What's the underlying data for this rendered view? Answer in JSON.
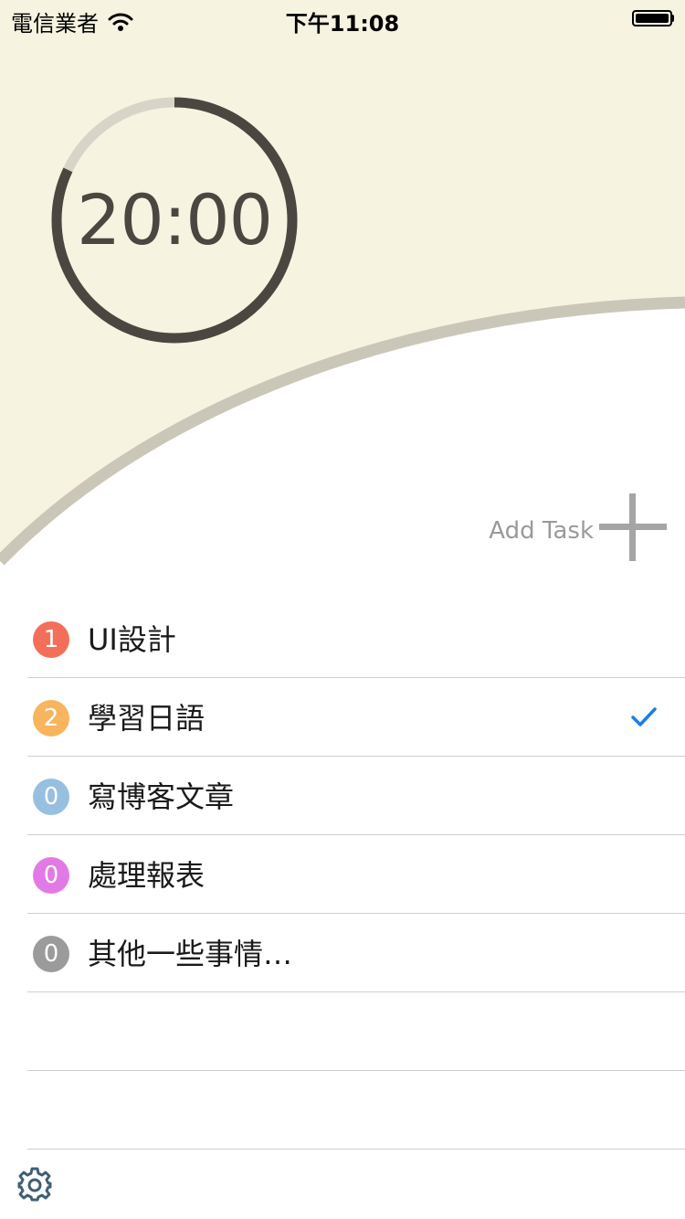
{
  "status_bar": {
    "carrier": "電信業者",
    "time": "下午11:08",
    "battery_level": 1.0
  },
  "timer": {
    "display": "20:00",
    "progress": 0.82,
    "ring_color": "#4b4740",
    "track_color": "#d8d5c8"
  },
  "colors": {
    "top_background": "#f6f3e1",
    "wave_stroke": "#cbc7b8",
    "accent_check": "#1a7ee8"
  },
  "add_task": {
    "label": "Add Task",
    "icon": "plus-icon"
  },
  "tasks": [
    {
      "count": "1",
      "name": "UI設計",
      "color": "#f46f5a",
      "checked": false
    },
    {
      "count": "2",
      "name": "學習日語",
      "color": "#f8b55d",
      "checked": true
    },
    {
      "count": "0",
      "name": "寫博客文章",
      "color": "#97bfe0",
      "checked": false
    },
    {
      "count": "0",
      "name": "處理報表",
      "color": "#e27ae6",
      "checked": false
    },
    {
      "count": "0",
      "name": "其他一些事情…",
      "color": "#9b9b9b",
      "checked": false
    }
  ],
  "settings": {
    "icon": "gear-icon"
  }
}
